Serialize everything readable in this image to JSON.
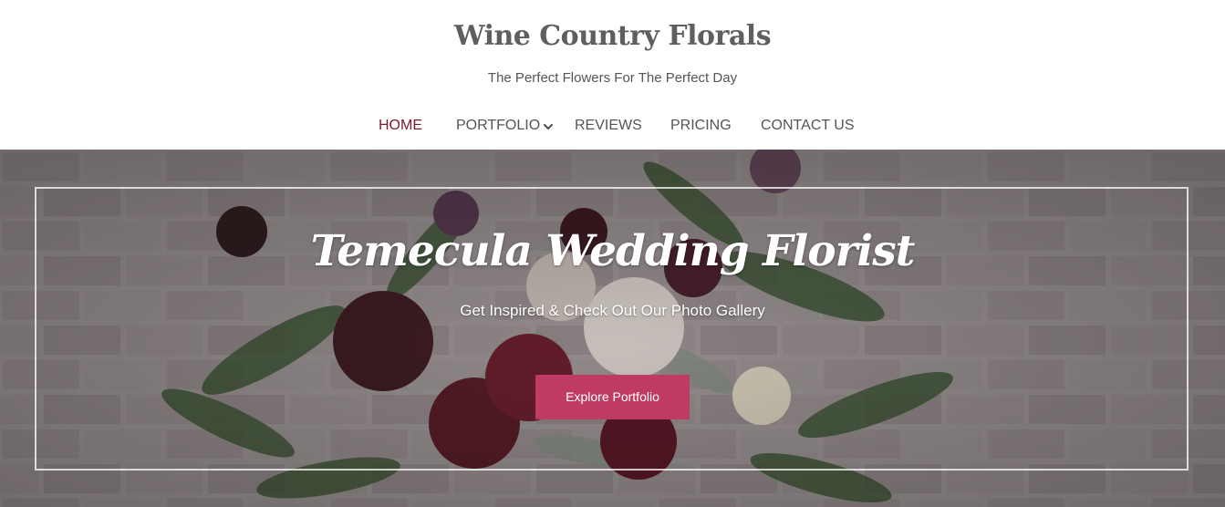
{
  "site": {
    "title": "Wine Country Florals",
    "tagline": "The Perfect Flowers For The Perfect Day"
  },
  "nav": {
    "items": [
      {
        "label": "HOME",
        "active": true
      },
      {
        "label": "PORTFOLIO",
        "has_dropdown": true
      },
      {
        "label": "REVIEWS"
      },
      {
        "label": "PRICING"
      },
      {
        "label": "CONTACT US"
      }
    ]
  },
  "hero": {
    "heading": "Temecula Wedding Florist",
    "subheading": "Get Inspired & Check Out Our Photo Gallery",
    "cta_label": "Explore Portfolio",
    "background_image": "bouquet-on-brick-wall-photo"
  },
  "colors": {
    "accent": "#7a1a2c",
    "button": "#bf3b63",
    "text": "#555555",
    "title": "#5f5f5f"
  }
}
